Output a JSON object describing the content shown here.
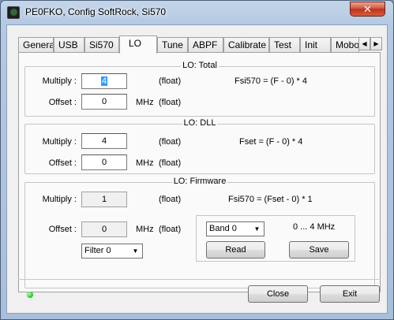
{
  "window": {
    "title": "PE0FKO, Config SoftRock, Si570",
    "close_glyph": "✕"
  },
  "tabs": [
    {
      "label": "General"
    },
    {
      "label": "USB"
    },
    {
      "label": "Si570"
    },
    {
      "label": "LO",
      "active": true
    },
    {
      "label": "Tune"
    },
    {
      "label": "ABPF"
    },
    {
      "label": "Calibrate"
    },
    {
      "label": "Test"
    },
    {
      "label": "Init"
    },
    {
      "label": "Mobo"
    }
  ],
  "tab_scroll": {
    "left": "◀",
    "right": "▶"
  },
  "lo_total": {
    "title": "LO: Total",
    "multiply_label": "Multiply :",
    "multiply_value": "4",
    "multiply_type": "(float)",
    "formula": "Fsi570 = (F - 0) * 4",
    "offset_label": "Offset :",
    "offset_value": "0",
    "offset_unit": "MHz",
    "offset_type": "(float)"
  },
  "lo_dll": {
    "title": "LO: DLL",
    "multiply_label": "Multiply :",
    "multiply_value": "4",
    "multiply_type": "(float)",
    "formula": "Fset = (F - 0) * 4",
    "offset_label": "Offset :",
    "offset_value": "0",
    "offset_unit": "MHz",
    "offset_type": "(float)"
  },
  "lo_firmware": {
    "title": "LO: Firmware",
    "multiply_label": "Multiply :",
    "multiply_value": "1",
    "multiply_type": "(float)",
    "formula": "Fsi570 = (Fset - 0) * 1",
    "offset_label": "Offset :",
    "offset_value": "0",
    "offset_unit": "MHz",
    "offset_type": "(float)",
    "filter_select": "Filter 0",
    "band_select": "Band 0",
    "band_range": "0 ... 4 MHz",
    "read_label": "Read",
    "save_label": "Save"
  },
  "footer": {
    "status_led_color": "#22d022",
    "close_label": "Close",
    "exit_label": "Exit"
  }
}
